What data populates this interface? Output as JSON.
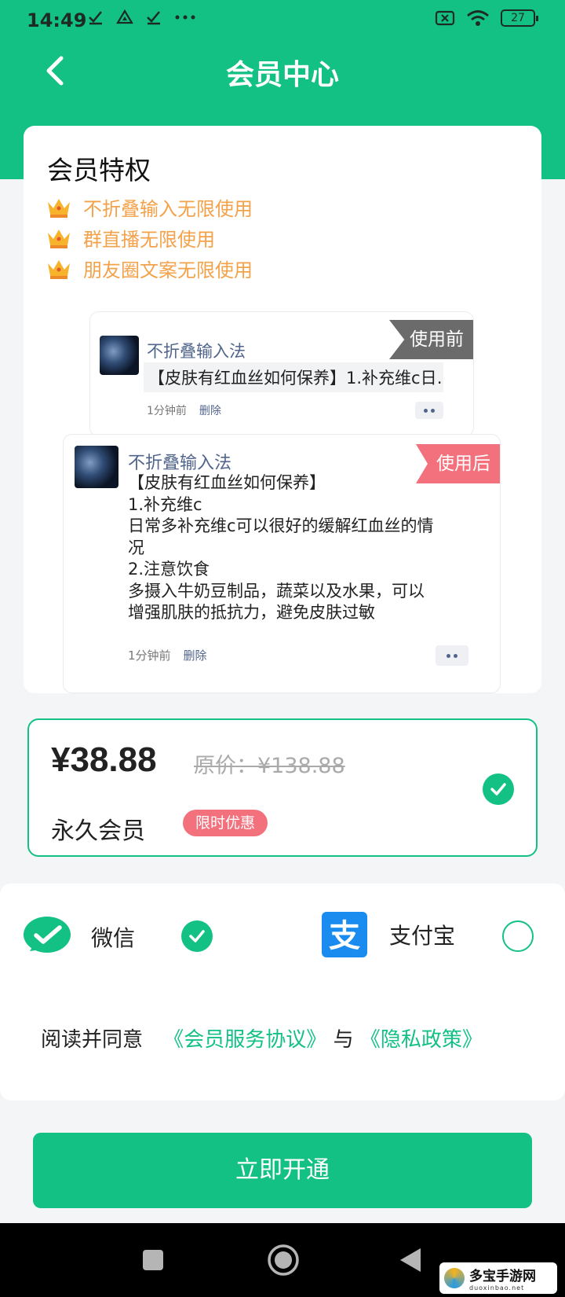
{
  "status_bar": {
    "time": "14:49",
    "battery": "27",
    "left_icons": [
      "check-icon",
      "drive-icon",
      "check-icon",
      "more-dots-icon"
    ],
    "right_icons": [
      "no-sim-icon",
      "wifi-icon",
      "battery-icon"
    ]
  },
  "header": {
    "title": "会员中心",
    "back_icon": "chevron-left-icon"
  },
  "privileges": {
    "title": "会员特权",
    "items": [
      {
        "icon": "crown-icon",
        "label": "不折叠输入无限使用"
      },
      {
        "icon": "crown-icon",
        "label": "群直播无限使用"
      },
      {
        "icon": "crown-icon",
        "label": "朋友圈文案无限使用"
      }
    ]
  },
  "demo_before": {
    "tag": "使用前",
    "name": "不折叠输入法",
    "snippet": "【皮肤有红血丝如何保养】1.补充维c日…",
    "time": "1分钟前",
    "delete_label": "删除"
  },
  "demo_after": {
    "tag": "使用后",
    "name": "不折叠输入法",
    "lines": [
      "【皮肤有红血丝如何保养】",
      "1.补充维c",
      "日常多补充维c可以很好的缓解红血丝的情",
      "况",
      "2.注意饮食",
      "多摄入牛奶豆制品，蔬菜以及水果，可以",
      "增强肌肤的抵抗力，避免皮肤过敏"
    ],
    "time": "1分钟前",
    "delete_label": "删除"
  },
  "plan": {
    "price": "¥38.88",
    "original_price": "原价：¥138.88",
    "name": "永久会员",
    "badge": "限时优惠",
    "selected": true
  },
  "payment": {
    "wechat": {
      "label": "微信",
      "icon": "wechat-pay-icon",
      "selected": true
    },
    "alipay": {
      "label": "支付宝",
      "icon": "alipay-icon",
      "selected": false
    },
    "agreement": {
      "prefix": "阅读并同意",
      "terms_link": "《会员服务协议》",
      "connector": "与",
      "privacy_link": "《隐私政策》"
    }
  },
  "cta": {
    "label": "立即开通"
  },
  "colors": {
    "brand": "#13c184",
    "perk_text": "#f3a24a",
    "tag_before": "#6b6b6b",
    "tag_after": "#f2717d",
    "alipay": "#1a8cf0"
  },
  "watermark": {
    "cn": "多宝手游网",
    "en": "duoxinbao.net"
  }
}
